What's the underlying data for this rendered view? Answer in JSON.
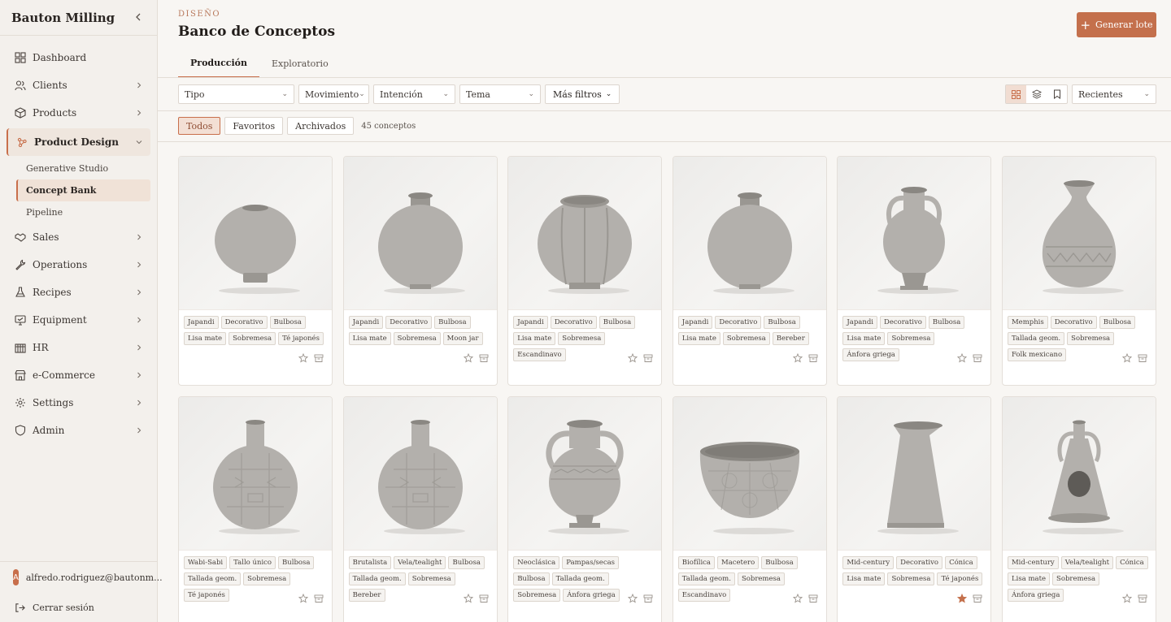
{
  "sidebar": {
    "brand": "Bauton Milling",
    "items": [
      {
        "label": "Dashboard",
        "icon": "dashboard-icon",
        "chev": false
      },
      {
        "label": "Clients",
        "icon": "users-icon",
        "chev": true
      },
      {
        "label": "Products",
        "icon": "box-icon",
        "chev": true
      },
      {
        "label": "Product Design",
        "icon": "sparkle-icon",
        "chev": true,
        "active": true
      },
      {
        "label": "Sales",
        "icon": "handshake-icon",
        "chev": true
      },
      {
        "label": "Operations",
        "icon": "wrench-icon",
        "chev": true
      },
      {
        "label": "Recipes",
        "icon": "flask-icon",
        "chev": true
      },
      {
        "label": "Equipment",
        "icon": "monitor-icon",
        "chev": true
      },
      {
        "label": "HR",
        "icon": "building-icon",
        "chev": true
      },
      {
        "label": "e-Commerce",
        "icon": "store-icon",
        "chev": true
      },
      {
        "label": "Settings",
        "icon": "gear-icon",
        "chev": true
      },
      {
        "label": "Admin",
        "icon": "shield-icon",
        "chev": true
      }
    ],
    "subitems": [
      "Generative Studio",
      "Concept Bank",
      "Pipeline"
    ],
    "user": {
      "initial": "A",
      "email": "alfredo.rodriguez@bautonm..."
    },
    "logout": "Cerrar sesión"
  },
  "header": {
    "eyebrow": "DISEÑO",
    "title": "Banco de Conceptos",
    "generate": "Generar lote"
  },
  "tabs": [
    "Producción",
    "Exploratorio"
  ],
  "filters": {
    "tipo": "Tipo",
    "movimiento": "Movimiento",
    "intencion": "Intención",
    "tema": "Tema",
    "more": "Más filtros",
    "sort": "Recientes"
  },
  "segments": [
    "Todos",
    "Favoritos",
    "Archivados"
  ],
  "count": "45 conceptos",
  "colors": {
    "accent": "#c4704c",
    "star_on": "#c4704c"
  },
  "cards": [
    {
      "shape": "round-low",
      "tags": [
        "Japandi",
        "Decorativo",
        "Bulbosa",
        "Lisa mate",
        "Sobremesa",
        "Té japonés"
      ],
      "fav": false
    },
    {
      "shape": "round",
      "tags": [
        "Japandi",
        "Decorativo",
        "Bulbosa",
        "Lisa mate",
        "Sobremesa",
        "Moon jar"
      ],
      "fav": false
    },
    {
      "shape": "lobed",
      "tags": [
        "Japandi",
        "Decorativo",
        "Bulbosa",
        "Lisa mate",
        "Sobremesa",
        "Escandinavo"
      ],
      "fav": false
    },
    {
      "shape": "round",
      "tags": [
        "Japandi",
        "Decorativo",
        "Bulbosa",
        "Lisa mate",
        "Sobremesa",
        "Bereber"
      ],
      "fav": false
    },
    {
      "shape": "amphora",
      "tags": [
        "Japandi",
        "Decorativo",
        "Bulbosa",
        "Lisa mate",
        "Sobremesa",
        "Ánfora griega"
      ],
      "fav": false
    },
    {
      "shape": "vase-carved",
      "tags": [
        "Memphis",
        "Decorativo",
        "Bulbosa",
        "Tallada geom.",
        "Sobremesa",
        "Folk mexicano"
      ],
      "fav": false
    },
    {
      "shape": "bottle-carved",
      "tags": [
        "Wabi-Sabi",
        "Tallo único",
        "Bulbosa",
        "Tallada geom.",
        "Sobremesa",
        "Té japonés"
      ],
      "fav": false
    },
    {
      "shape": "bottle-carved",
      "tags": [
        "Brutalista",
        "Vela/tealight",
        "Bulbosa",
        "Tallada geom.",
        "Sobremesa",
        "Bereber"
      ],
      "fav": false
    },
    {
      "shape": "amphora-carved",
      "tags": [
        "Neoclásica",
        "Pampas/secas",
        "Bulbosa",
        "Tallada geom.",
        "Sobremesa",
        "Ánfora griega"
      ],
      "fav": false
    },
    {
      "shape": "bowl-carved",
      "tags": [
        "Biofílica",
        "Macetero",
        "Bulbosa",
        "Tallada geom.",
        "Sobremesa",
        "Escandinavo"
      ],
      "fav": false
    },
    {
      "shape": "conical",
      "tags": [
        "Mid-century",
        "Decorativo",
        "Cónica",
        "Lisa mate",
        "Sobremesa",
        "Té japonés"
      ],
      "fav": true
    },
    {
      "shape": "lantern",
      "tags": [
        "Mid-century",
        "Vela/tealight",
        "Cónica",
        "Lisa mate",
        "Sobremesa",
        "Ánfora griega"
      ],
      "fav": false
    }
  ]
}
